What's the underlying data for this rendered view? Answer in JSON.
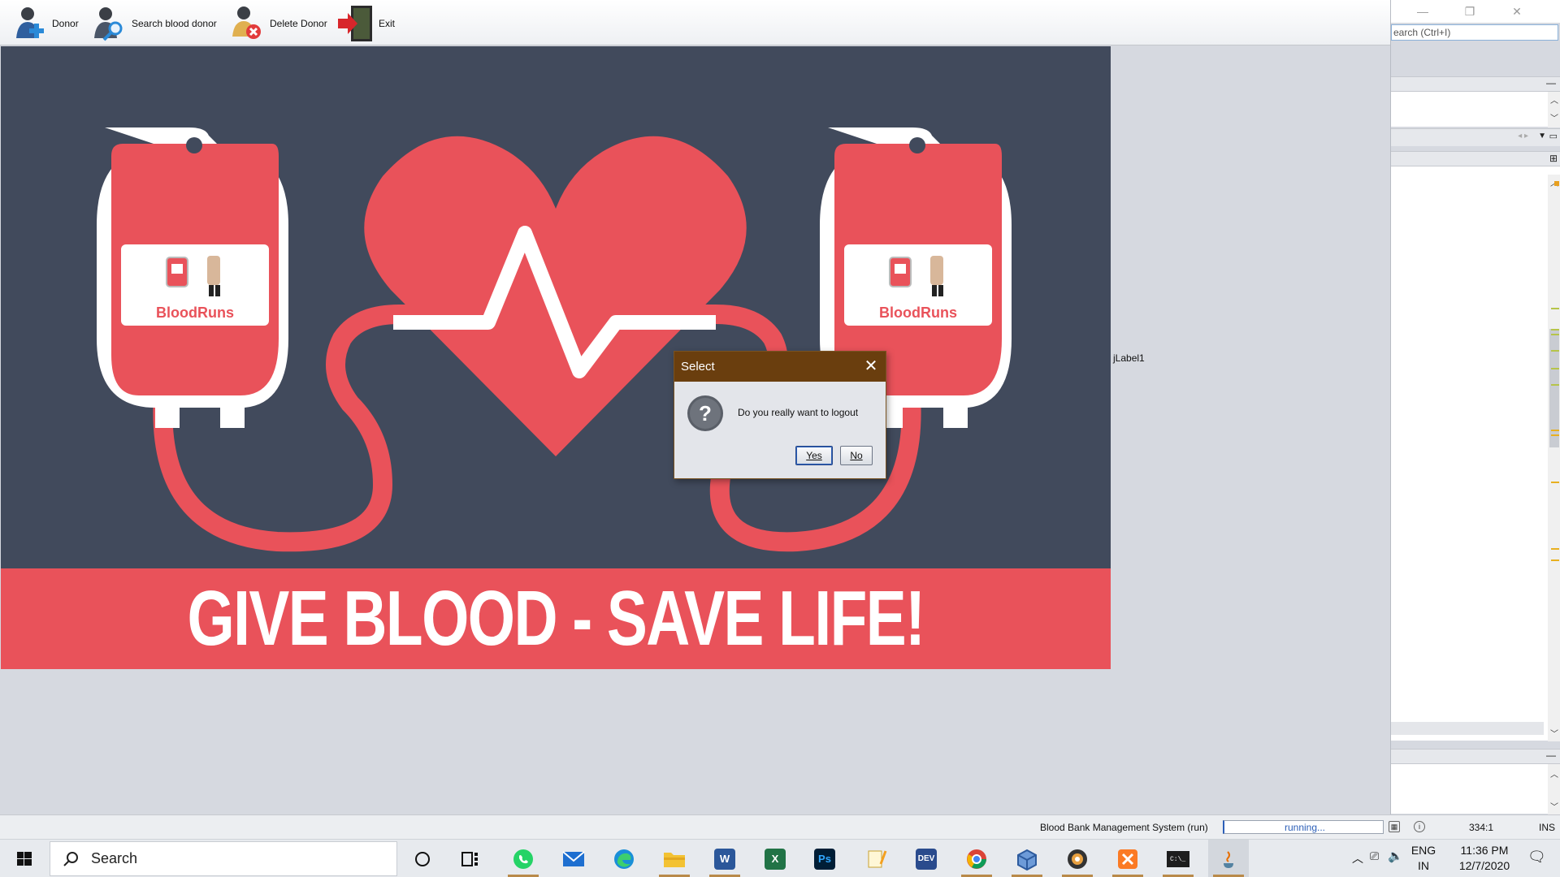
{
  "toolbar": {
    "items": [
      {
        "label": "Donor",
        "icon": "add-user-icon"
      },
      {
        "label": "Search blood donor",
        "icon": "search-user-icon"
      },
      {
        "label": "Delete Donor",
        "icon": "delete-user-icon"
      },
      {
        "label": "Exit",
        "icon": "exit-door-icon"
      }
    ]
  },
  "banner": {
    "brand_left": "BloodRuns",
    "brand_right": "BloodRuns",
    "slogan": "GIVE BLOOD - SAVE LIFE!"
  },
  "jlabel": "jLabel1",
  "dialog": {
    "title": "Select",
    "message": "Do you really want to logout",
    "yes_label": "Yes",
    "no_label": "No",
    "icon": "question-icon"
  },
  "ide": {
    "search_placeholder": "Search (Ctrl+I)",
    "search_visible_text": "earch (Ctrl+I)"
  },
  "statusbar": {
    "project": "Blood Bank Management System (run)",
    "progress_text": "running...",
    "position": "334:1",
    "mode": "INS"
  },
  "taskbar": {
    "search_text": "Search",
    "apps": [
      {
        "name": "cortana",
        "icon": "cortana-circle-icon"
      },
      {
        "name": "task-view",
        "icon": "task-view-icon"
      },
      {
        "name": "whatsapp",
        "icon": "whatsapp-icon",
        "color": "#25d366"
      },
      {
        "name": "mail",
        "icon": "mail-icon",
        "color": "#1e6fd0"
      },
      {
        "name": "edge",
        "icon": "edge-icon",
        "color": "#1a8fd8"
      },
      {
        "name": "file-explorer",
        "icon": "folder-icon",
        "color": "#f3c233"
      },
      {
        "name": "word",
        "icon": "word-icon",
        "color": "#2b579a",
        "glyph": "W"
      },
      {
        "name": "excel",
        "icon": "excel-icon",
        "color": "#217346",
        "glyph": "X"
      },
      {
        "name": "photoshop",
        "icon": "photoshop-icon",
        "color": "#001e36",
        "glyph": "Ps"
      },
      {
        "name": "notepad",
        "icon": "notepad-icon",
        "color": "#f4c542"
      },
      {
        "name": "devcpp",
        "icon": "dev-icon",
        "color": "#2a4b8d",
        "glyph": "DEV"
      },
      {
        "name": "chrome",
        "icon": "chrome-icon",
        "color": "#db4437"
      },
      {
        "name": "virtualbox",
        "icon": "cube-icon",
        "color": "#3f6fb6"
      },
      {
        "name": "media-player",
        "icon": "disc-icon",
        "color": "#333333"
      },
      {
        "name": "xampp",
        "icon": "xampp-icon",
        "color": "#fb7a24"
      },
      {
        "name": "terminal",
        "icon": "terminal-icon",
        "color": "#1d1d1d"
      },
      {
        "name": "java",
        "icon": "java-icon",
        "color": "#e76f00"
      }
    ],
    "lang_line1": "ENG",
    "lang_line2": "IN",
    "time": "11:36 PM",
    "date": "12/7/2020"
  },
  "colors": {
    "banner_bg": "#414a5c",
    "blood_red": "#e9525a",
    "dialog_title_bg": "#6a3e0e"
  }
}
